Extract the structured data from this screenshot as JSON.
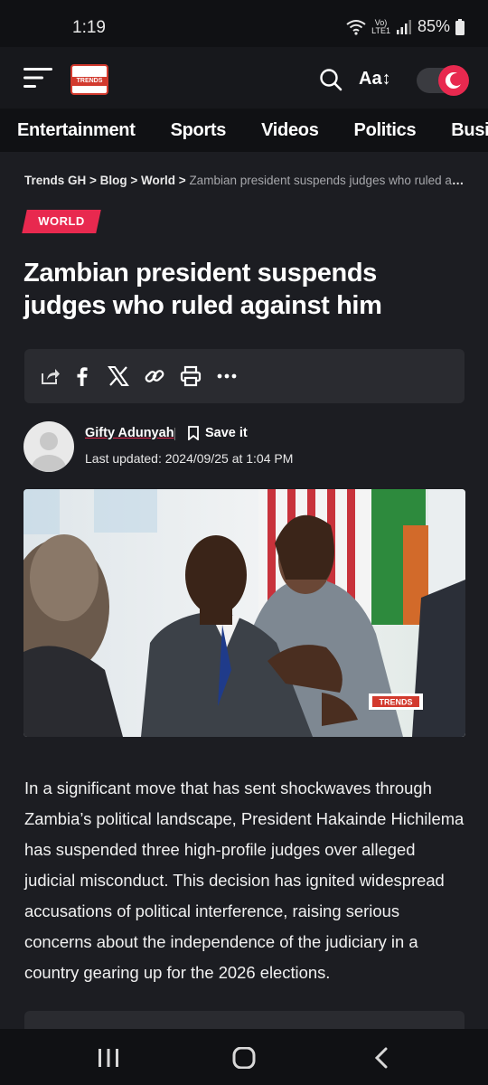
{
  "status": {
    "time": "1:19",
    "network": "LTE1",
    "volte": "Vo)",
    "battery": "85%"
  },
  "appbar": {
    "logo_text": "TRENDS",
    "font_size_label": "Aa↕"
  },
  "categories": [
    "Entertainment",
    "Sports",
    "Videos",
    "Politics",
    "Business"
  ],
  "breadcrumb": {
    "home": "Trends GH",
    "blog": "Blog",
    "section": "World",
    "current": "Zambian president suspends judges who ruled against ..."
  },
  "article": {
    "category": "WORLD",
    "title": "Zambian president suspends judges who ruled against him",
    "author": "Gifty Adunyah",
    "save_label": "Save it",
    "updated": "Last updated: 2024/09/25 at 1:04 PM",
    "image_watermark": "TRENDS",
    "body": "In a significant move that has sent shockwaves through Zambia’s political landscape, President Hakainde Hichilema has suspended three high-profile judges over alleged judicial misconduct. This decision has ignited widespread accusations of political interference, raising serious concerns about the independence of the judiciary in a country gearing up for the 2026 elections."
  },
  "share_icons": [
    "share-icon",
    "facebook-icon",
    "x-icon",
    "link-icon",
    "print-icon",
    "more-icon"
  ],
  "colors": {
    "accent": "#e8294f",
    "background": "#1c1d22",
    "bar": "#101114"
  }
}
